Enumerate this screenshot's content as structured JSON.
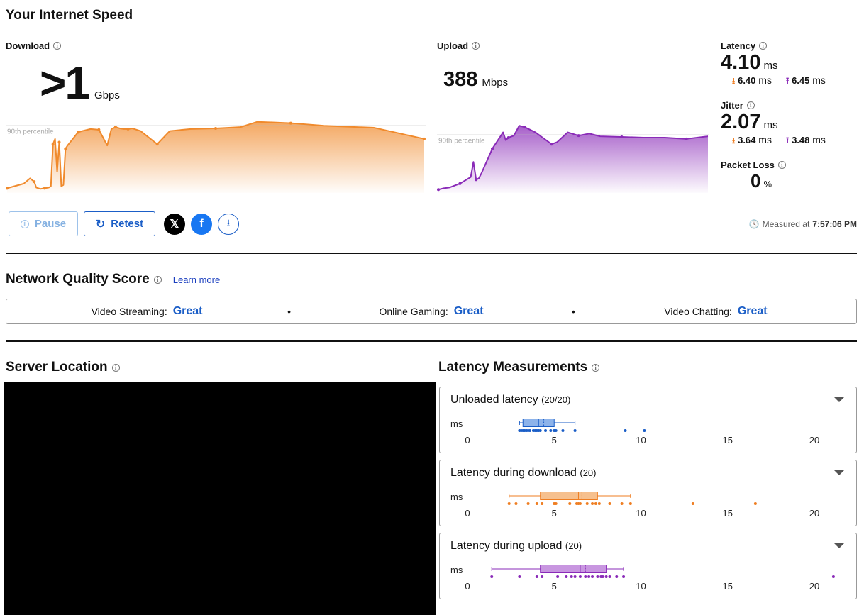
{
  "header": {
    "title": "Your Internet Speed"
  },
  "download": {
    "label": "Download",
    "value": ">1",
    "unit": "Gbps",
    "percentile_label": "90th percentile"
  },
  "upload": {
    "label": "Upload",
    "value": "388",
    "unit": "Mbps",
    "percentile_label": "90th percentile"
  },
  "latency": {
    "label": "Latency",
    "value": "4.10",
    "unit": "ms",
    "down": "6.40",
    "up": "6.45",
    "sub_unit": "ms"
  },
  "jitter": {
    "label": "Jitter",
    "value": "2.07",
    "unit": "ms",
    "down": "3.64",
    "up": "3.48",
    "sub_unit": "ms"
  },
  "packet_loss": {
    "label": "Packet Loss",
    "value": "0",
    "unit": "%"
  },
  "actions": {
    "pause": "Pause",
    "retest": "Retest"
  },
  "measured": {
    "prefix": "Measured at",
    "time": "7:57:06 PM"
  },
  "network_quality": {
    "title": "Network Quality Score",
    "learn_more": "Learn more",
    "items": [
      {
        "label": "Video Streaming:",
        "score": "Great"
      },
      {
        "label": "Online Gaming:",
        "score": "Great"
      },
      {
        "label": "Video Chatting:",
        "score": "Great"
      }
    ]
  },
  "server_location": {
    "title": "Server Location"
  },
  "latency_measurements": {
    "title": "Latency Measurements",
    "axis_ticks": [
      "0",
      "5",
      "10",
      "15",
      "20"
    ],
    "unit": "ms",
    "cards": [
      {
        "title": "Unloaded latency",
        "count": "(20/20)",
        "color": "#1b5ec7",
        "fill": "#8db3ea",
        "box": {
          "min": 3.0,
          "q1": 3.2,
          "median": 4.1,
          "mean": 4.4,
          "q3": 5.0,
          "max": 6.2
        },
        "points": [
          3.0,
          3.1,
          3.2,
          3.3,
          3.4,
          3.5,
          3.6,
          3.8,
          4.0,
          4.1,
          4.2,
          4.5,
          4.8,
          5.0,
          5.1,
          5.5,
          6.2,
          9.1,
          10.2,
          3.9
        ]
      },
      {
        "title": "Latency during download",
        "count": "(20)",
        "color": "#ef7e22",
        "fill": "#f6c08e",
        "box": {
          "min": 2.4,
          "q1": 4.2,
          "median": 6.4,
          "mean": 6.6,
          "q3": 7.5,
          "max": 9.4
        },
        "points": [
          2.4,
          2.8,
          3.5,
          4.0,
          4.3,
          5.0,
          5.1,
          5.9,
          6.3,
          6.4,
          6.5,
          7.2,
          7.4,
          7.6,
          8.2,
          8.9,
          9.4,
          13.0,
          16.6,
          6.9
        ]
      },
      {
        "title": "Latency during upload",
        "count": "(20)",
        "color": "#8a2bb8",
        "fill": "#c896e0",
        "box": {
          "min": 1.4,
          "q1": 4.2,
          "median": 6.5,
          "mean": 6.8,
          "q3": 8.0,
          "max": 9.0
        },
        "points": [
          1.4,
          3.0,
          4.0,
          4.3,
          5.2,
          5.7,
          6.0,
          6.5,
          6.8,
          7.0,
          7.2,
          7.5,
          7.8,
          8.0,
          8.2,
          8.6,
          9.0,
          21.1,
          6.2,
          7.7
        ]
      }
    ]
  },
  "chart_data": [
    {
      "type": "area",
      "title": "Download",
      "ylabel": "",
      "xlabel": "",
      "x": [
        0,
        4,
        5.5,
        6.5,
        7,
        8,
        9,
        10,
        10.5,
        11,
        11.5,
        12,
        12.5,
        13,
        13.5,
        14,
        14.5,
        16,
        17,
        18,
        20,
        22,
        24,
        25,
        26,
        27,
        28,
        29,
        30,
        32,
        36,
        39,
        44,
        50,
        56,
        60,
        68,
        76,
        88,
        100
      ],
      "values": [
        5,
        12,
        20,
        15,
        6,
        4,
        5,
        6,
        8,
        72,
        80,
        30,
        75,
        8,
        10,
        65,
        70,
        82,
        90,
        92,
        95,
        94,
        70,
        95,
        98,
        96,
        95,
        95,
        96,
        92,
        72,
        92,
        95,
        96,
        98,
        106,
        104,
        100,
        97,
        80
      ],
      "percentile_90": 100
    },
    {
      "type": "area",
      "title": "Upload",
      "ylabel": "",
      "xlabel": "",
      "x": [
        0,
        2,
        4,
        8,
        12,
        13,
        14,
        15,
        16,
        20,
        24,
        25,
        26,
        28,
        30,
        32,
        36,
        40,
        42,
        44,
        48,
        52,
        56,
        60,
        68,
        76,
        84,
        92,
        100
      ],
      "values": [
        3,
        5,
        6,
        12,
        22,
        45,
        18,
        20,
        28,
        65,
        90,
        78,
        82,
        85,
        100,
        98,
        90,
        78,
        72,
        75,
        90,
        85,
        88,
        84,
        83,
        82,
        82,
        80,
        84
      ],
      "percentile_90": 86
    }
  ]
}
